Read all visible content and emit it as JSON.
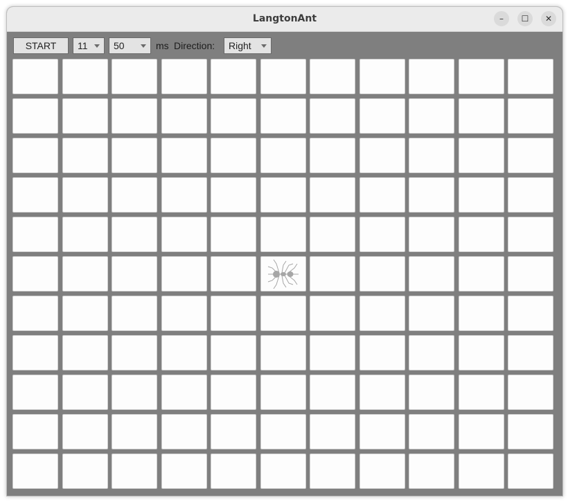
{
  "window": {
    "title": "LangtonAnt",
    "min_glyph": "–",
    "max_glyph": "☐",
    "close_glyph": "✕"
  },
  "toolbar": {
    "start_label": "START",
    "size_value": "11",
    "delay_value": "50",
    "ms_label": "ms",
    "direction_label": "Direction:",
    "direction_value": "Right"
  },
  "grid": {
    "rows": 11,
    "cols": 11,
    "ant_row": 5,
    "ant_col": 5,
    "ant_direction": "right",
    "black_cells": []
  },
  "colors": {
    "background": "#7f7f7f",
    "cell_white": "#fdfdfd",
    "ant": "#a6a6a6"
  }
}
